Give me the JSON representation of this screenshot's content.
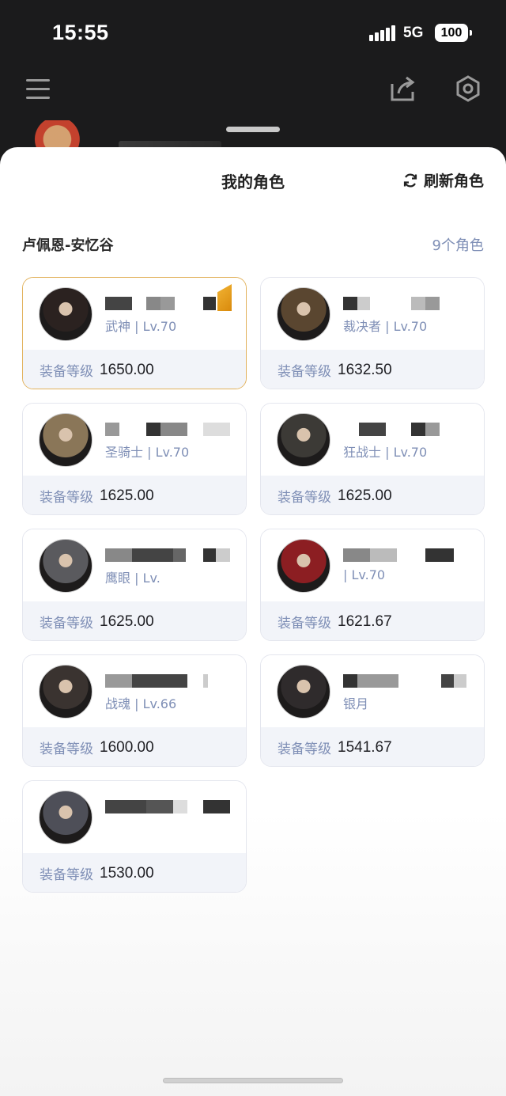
{
  "status": {
    "time": "15:55",
    "network": "5G",
    "battery": "100"
  },
  "sheet": {
    "title": "我的角色",
    "refresh_label": "刷新角色",
    "server_name": "卢佩恩-安忆谷",
    "character_count": "9个角色",
    "gear_label": "装备等级"
  },
  "characters": [
    {
      "class_level": "武神 | Lv.70",
      "gear_score": "1650.00",
      "selected": true,
      "avatar_color": "#2b2220"
    },
    {
      "class_level": "裁决者 | Lv.70",
      "gear_score": "1632.50",
      "selected": false,
      "avatar_color": "#5a4630"
    },
    {
      "class_level": "圣骑士 | Lv.70",
      "gear_score": "1625.00",
      "selected": false,
      "avatar_color": "#8a7658"
    },
    {
      "class_level": "狂战士 | Lv.70",
      "gear_score": "1625.00",
      "selected": false,
      "avatar_color": "#3c3a36"
    },
    {
      "class_level": "鹰眼 | Lv.",
      "gear_score": "1625.00",
      "selected": false,
      "avatar_color": "#5a5a5e"
    },
    {
      "class_level": "| Lv.70",
      "gear_score": "1621.67",
      "selected": false,
      "avatar_color": "#8c1e22"
    },
    {
      "class_level": "战魂 | Lv.66",
      "gear_score": "1600.00",
      "selected": false,
      "avatar_color": "#3a3330"
    },
    {
      "class_level": "银月",
      "gear_score": "1541.67",
      "selected": false,
      "avatar_color": "#2f2b2c"
    },
    {
      "class_level": "",
      "gear_score": "1530.00",
      "selected": false,
      "avatar_color": "#4e4f58"
    }
  ],
  "icons": {
    "menu": "menu-icon",
    "share": "share-icon",
    "settings": "hexagon-settings-icon",
    "refresh": "refresh-icon"
  }
}
